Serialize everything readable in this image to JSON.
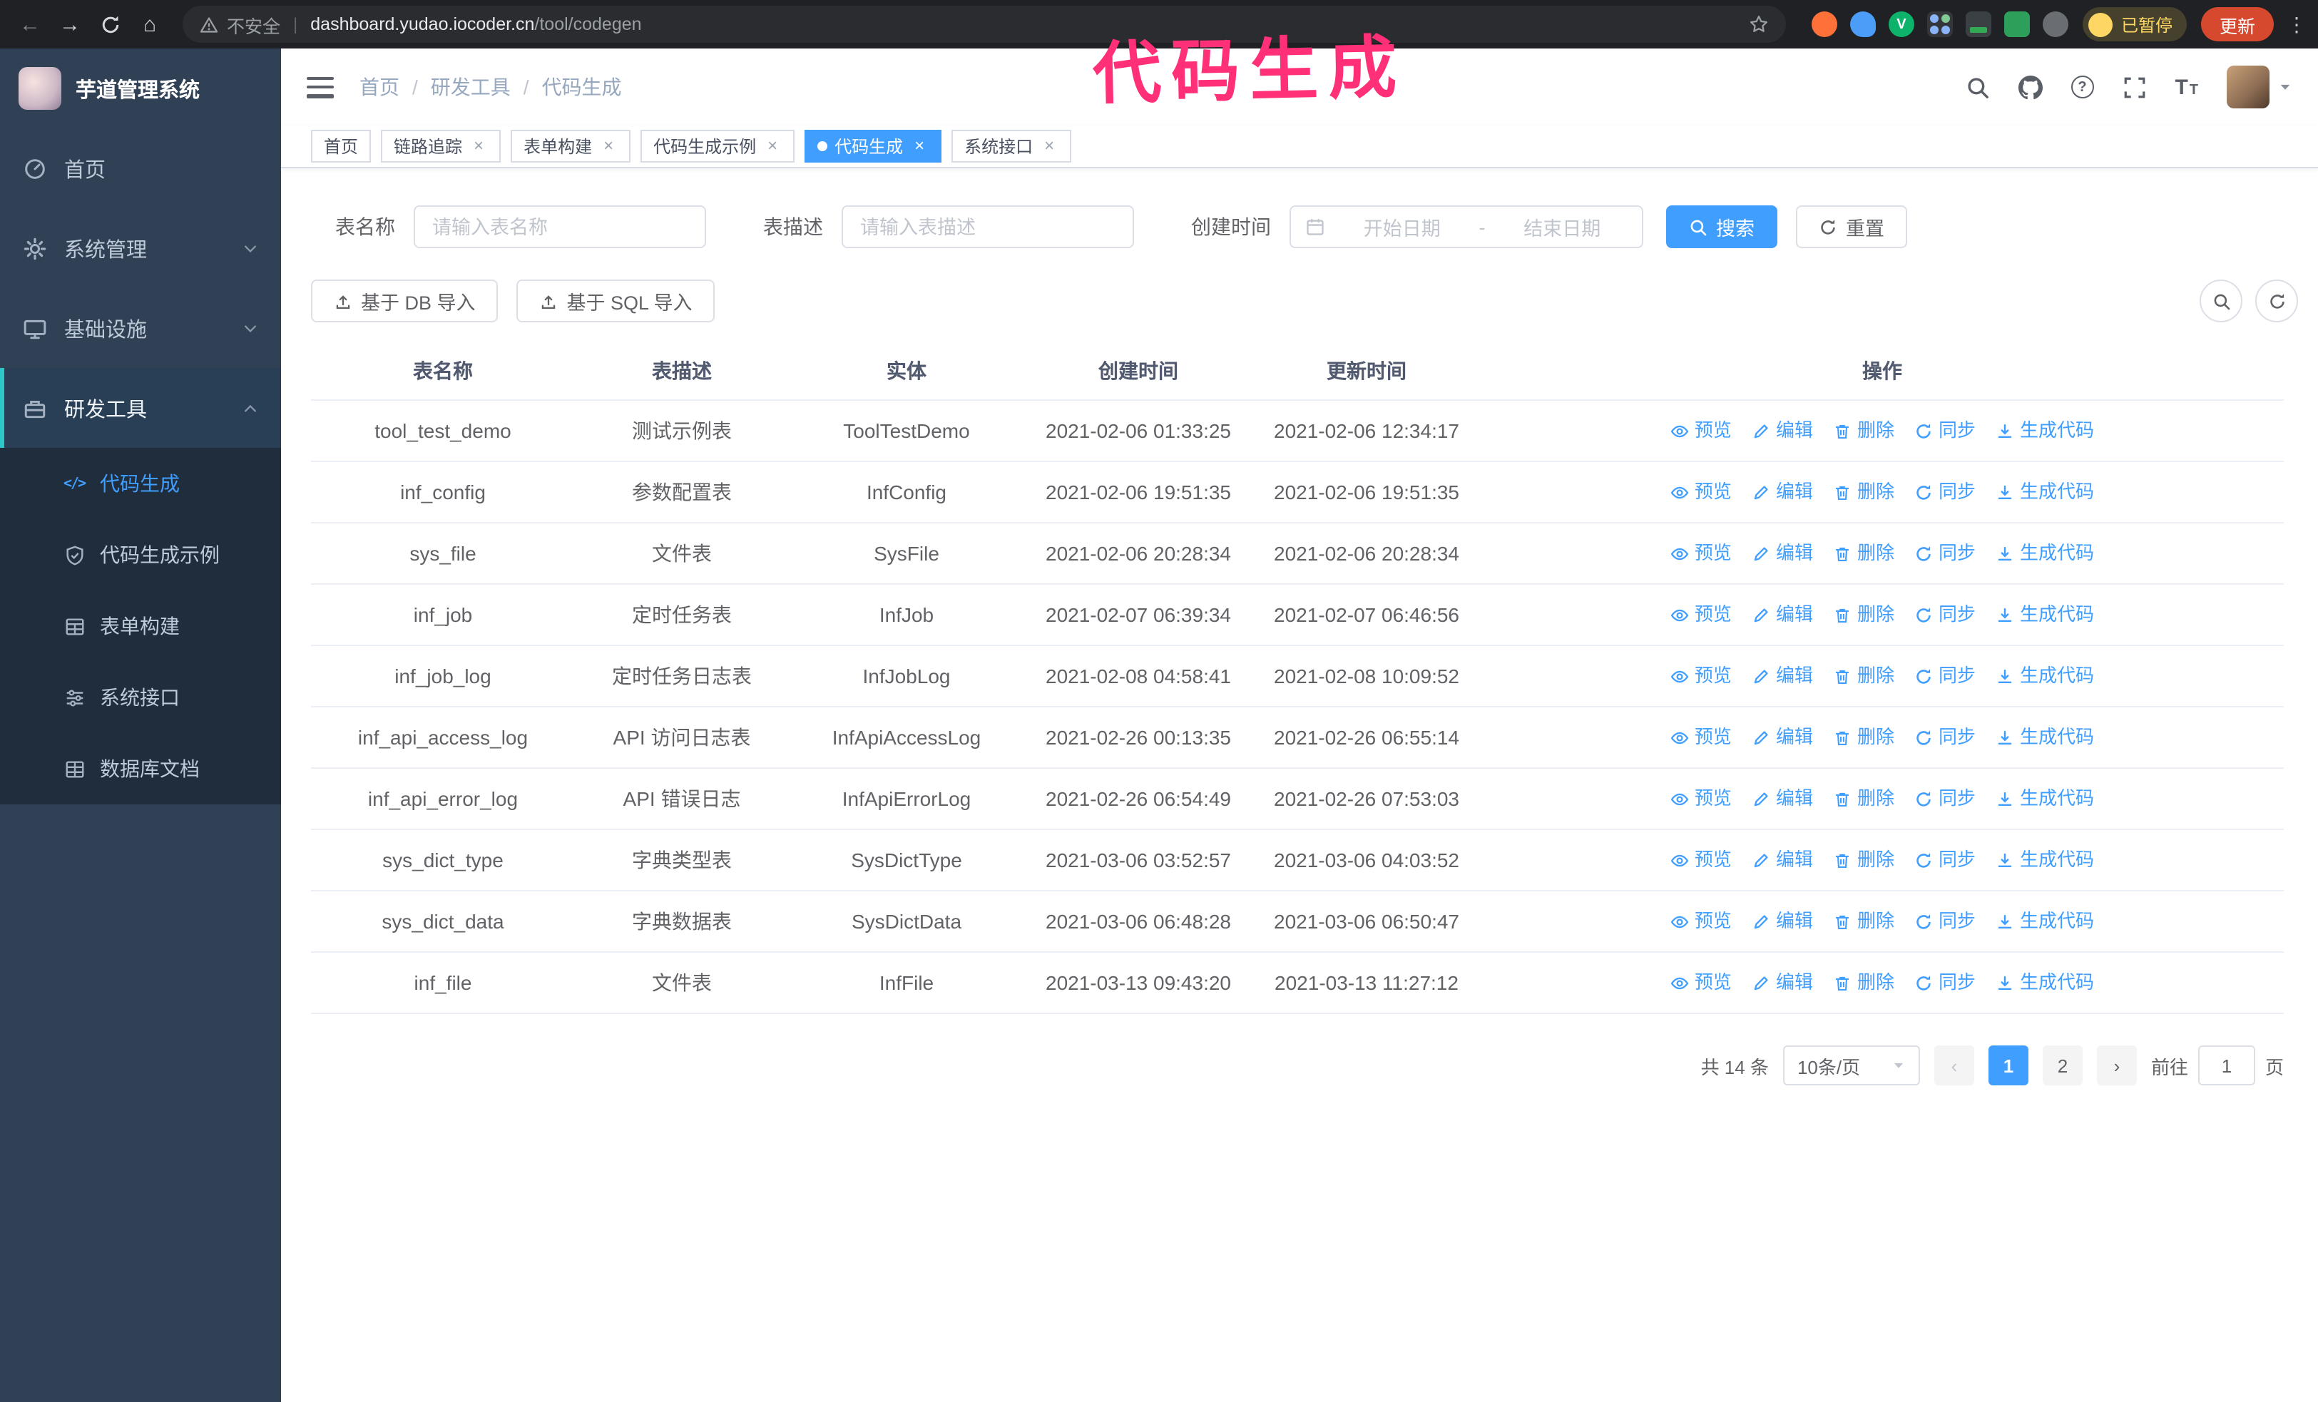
{
  "annotation": {
    "text": "代码生成"
  },
  "browser": {
    "security_label": "不安全",
    "url_host": "dashboard.yudao.iocoder.cn",
    "url_path": "/tool/codegen",
    "paused_badge": "已暂停",
    "update_button": "更新"
  },
  "icons": {
    "back": "←",
    "forward": "→",
    "home": "⌂",
    "divider": "|",
    "ellipsis": "⋮",
    "close": "×",
    "breadcrumb_separator": "/",
    "question_mark": "?",
    "font_size_big": "T",
    "font_size_small": "T",
    "code": "</>",
    "prev": "‹",
    "next": "›",
    "extension_v": "V"
  },
  "sidebar": {
    "logo_title": "芋道管理系统",
    "items": [
      {
        "label": "首页"
      },
      {
        "label": "系统管理"
      },
      {
        "label": "基础设施"
      },
      {
        "label": "研发工具",
        "children": [
          {
            "label": "代码生成",
            "active": true
          },
          {
            "label": "代码生成示例"
          },
          {
            "label": "表单构建"
          },
          {
            "label": "系统接口"
          },
          {
            "label": "数据库文档"
          }
        ]
      }
    ]
  },
  "header": {
    "breadcrumb": [
      "首页",
      "研发工具",
      "代码生成"
    ]
  },
  "tabs": [
    {
      "label": "首页"
    },
    {
      "label": "链路追踪"
    },
    {
      "label": "表单构建"
    },
    {
      "label": "代码生成示例"
    },
    {
      "label": "代码生成",
      "active": true
    },
    {
      "label": "系统接口"
    }
  ],
  "filters": {
    "table_name_label": "表名称",
    "table_name_placeholder": "请输入表名称",
    "table_desc_label": "表描述",
    "table_desc_placeholder": "请输入表描述",
    "create_time_label": "创建时间",
    "date_start_placeholder": "开始日期",
    "date_range_separator": "-",
    "date_end_placeholder": "结束日期",
    "search_button": "搜索",
    "reset_button": "重置"
  },
  "toolbar": {
    "import_db_button": "基于 DB 导入",
    "import_sql_button": "基于 SQL 导入"
  },
  "table": {
    "columns": [
      "表名称",
      "表描述",
      "实体",
      "创建时间",
      "更新时间",
      "操作"
    ],
    "actions": [
      "预览",
      "编辑",
      "删除",
      "同步",
      "生成代码"
    ],
    "rows": [
      {
        "name": "tool_test_demo",
        "description": "测试示例表",
        "entity": "ToolTestDemo",
        "create_time": "2021-02-06 01:33:25",
        "update_time": "2021-02-06 12:34:17"
      },
      {
        "name": "inf_config",
        "description": "参数配置表",
        "entity": "InfConfig",
        "create_time": "2021-02-06 19:51:35",
        "update_time": "2021-02-06 19:51:35"
      },
      {
        "name": "sys_file",
        "description": "文件表",
        "entity": "SysFile",
        "create_time": "2021-02-06 20:28:34",
        "update_time": "2021-02-06 20:28:34"
      },
      {
        "name": "inf_job",
        "description": "定时任务表",
        "entity": "InfJob",
        "create_time": "2021-02-07 06:39:34",
        "update_time": "2021-02-07 06:46:56"
      },
      {
        "name": "inf_job_log",
        "description": "定时任务日志表",
        "entity": "InfJobLog",
        "create_time": "2021-02-08 04:58:41",
        "update_time": "2021-02-08 10:09:52"
      },
      {
        "name": "inf_api_access_log",
        "description": "API 访问日志表",
        "entity": "InfApiAccessLog",
        "create_time": "2021-02-26 00:13:35",
        "update_time": "2021-02-26 06:55:14"
      },
      {
        "name": "inf_api_error_log",
        "description": "API 错误日志",
        "entity": "InfApiErrorLog",
        "create_time": "2021-02-26 06:54:49",
        "update_time": "2021-02-26 07:53:03"
      },
      {
        "name": "sys_dict_type",
        "description": "字典类型表",
        "entity": "SysDictType",
        "create_time": "2021-03-06 03:52:57",
        "update_time": "2021-03-06 04:03:52"
      },
      {
        "name": "sys_dict_data",
        "description": "字典数据表",
        "entity": "SysDictData",
        "create_time": "2021-03-06 06:48:28",
        "update_time": "2021-03-06 06:50:47"
      },
      {
        "name": "inf_file",
        "description": "文件表",
        "entity": "InfFile",
        "create_time": "2021-03-13 09:43:20",
        "update_time": "2021-03-13 11:27:12"
      }
    ]
  },
  "pagination": {
    "total_text": "共 14 条",
    "page_size_label": "10条/页",
    "pages": [
      "1",
      "2"
    ],
    "active_page": "1",
    "goto_label": "前往",
    "goto_value": "1",
    "goto_unit": "页"
  },
  "colors": {
    "accent": "#409eff",
    "sidebar_bg": "#304156",
    "submenu_bg": "#1f2d3d",
    "chrome_bar": "#202124",
    "annotation": "#ff2f78",
    "update_button": "#d6492f",
    "tag_active": "#409eff"
  }
}
